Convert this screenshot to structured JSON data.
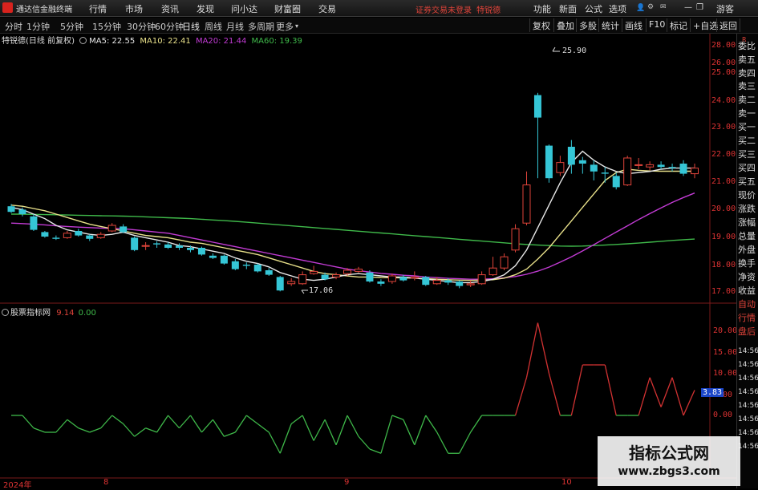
{
  "topbar": {
    "title": "通达信金融终端",
    "menu": [
      "行情",
      "市场",
      "资讯",
      "发现",
      "问小达",
      "财富圈",
      "交易"
    ],
    "notice": "证券交易未登录",
    "tag": "特锐德",
    "right_menu": [
      "功能",
      "新面",
      "公式",
      "选项"
    ],
    "guest": "游客"
  },
  "secbar": {
    "periods": [
      "分时",
      "1分钟",
      "5分钟",
      "15分钟",
      "30分钟",
      "60分钟",
      "日线",
      "周线",
      "月线",
      "多周期",
      "更多"
    ],
    "active": "日线",
    "buttons": [
      "复权",
      "叠加",
      "多股",
      "统计",
      "画线",
      "F10",
      "标记",
      "+自选",
      "返回"
    ]
  },
  "main_legend": {
    "title": "特锐德(日线 前复权)",
    "ma5": "MA5: 22.55",
    "ma10": "MA10: 22.41",
    "ma20": "MA20: 21.44",
    "ma60": "MA60: 19.39"
  },
  "sub_legend": {
    "title": "股票指标网",
    "v1": "9.14",
    "v2": "0.00"
  },
  "price_axis": [
    "28.00",
    "26.00",
    "25.00",
    "24.00",
    "23.00",
    "22.00",
    "21.00",
    "20.00",
    "19.00",
    "18.00",
    "17.00"
  ],
  "sub_axis": [
    "20.00",
    "15.00",
    "10.00",
    "5.00",
    "0.00"
  ],
  "sub_current": "3.83",
  "annotations": {
    "high": "25.90",
    "low": "17.06"
  },
  "dates": [
    "2024年",
    "8",
    "9",
    "10"
  ],
  "right_panel": [
    "委比",
    "卖五",
    "卖四",
    "卖三",
    "卖二",
    "卖一",
    "买一",
    "买二",
    "买三",
    "买四",
    "买五",
    "现价",
    "涨跌",
    "涨幅",
    "总量",
    "外盘",
    "换手",
    "净资",
    "收益",
    "自动",
    "行情",
    "盘后",
    "14:56",
    "14:56",
    "14:56",
    "14:56",
    "14:56",
    "14:56",
    "14:56",
    "14:56"
  ],
  "right_top": "R",
  "watermark": {
    "line1": "指标公式网",
    "line2": "www.zbgs3.com"
  },
  "colors": {
    "up": "#e0443a",
    "down": "#35c6d6",
    "ma5": "#e8e8e8",
    "ma10": "#e8e08a",
    "ma20": "#c23bd4",
    "ma60": "#3fb94a",
    "sub_up": "#d23232",
    "sub_down": "#3fb94a"
  },
  "chart_data": {
    "type": "candlestick",
    "price_ylim": [
      17.0,
      28.0
    ],
    "candles": [
      {
        "o": 20.85,
        "c": 20.6,
        "h": 20.95,
        "l": 20.55
      },
      {
        "o": 20.7,
        "c": 20.5,
        "h": 20.8,
        "l": 20.4
      },
      {
        "o": 20.4,
        "c": 19.8,
        "h": 20.5,
        "l": 19.75
      },
      {
        "o": 19.7,
        "c": 19.5,
        "h": 19.75,
        "l": 19.45
      },
      {
        "o": 19.45,
        "c": 19.4,
        "h": 19.55,
        "l": 19.35
      },
      {
        "o": 19.45,
        "c": 19.65,
        "h": 19.75,
        "l": 19.4
      },
      {
        "o": 19.75,
        "c": 19.55,
        "h": 19.85,
        "l": 19.5
      },
      {
        "o": 19.55,
        "c": 19.4,
        "h": 19.6,
        "l": 19.3
      },
      {
        "o": 19.45,
        "c": 19.6,
        "h": 19.7,
        "l": 19.4
      },
      {
        "o": 19.75,
        "c": 20.0,
        "h": 20.1,
        "l": 19.7
      },
      {
        "o": 19.95,
        "c": 19.7,
        "h": 20.05,
        "l": 19.65
      },
      {
        "o": 19.45,
        "c": 18.9,
        "h": 19.5,
        "l": 18.85
      },
      {
        "o": 19.1,
        "c": 19.1,
        "h": 19.25,
        "l": 18.9
      },
      {
        "o": 19.2,
        "c": 19.15,
        "h": 19.3,
        "l": 19.0
      },
      {
        "o": 19.15,
        "c": 19.0,
        "h": 19.25,
        "l": 18.95
      },
      {
        "o": 19.1,
        "c": 19.0,
        "h": 19.2,
        "l": 18.9
      },
      {
        "o": 19.0,
        "c": 18.9,
        "h": 19.1,
        "l": 18.8
      },
      {
        "o": 19.0,
        "c": 18.7,
        "h": 19.05,
        "l": 18.65
      },
      {
        "o": 18.65,
        "c": 18.55,
        "h": 18.75,
        "l": 18.5
      },
      {
        "o": 18.65,
        "c": 18.3,
        "h": 18.7,
        "l": 18.25
      },
      {
        "o": 18.4,
        "c": 18.05,
        "h": 18.5,
        "l": 18.0
      },
      {
        "o": 18.25,
        "c": 18.2,
        "h": 18.35,
        "l": 18.05
      },
      {
        "o": 18.25,
        "c": 17.95,
        "h": 18.3,
        "l": 17.9
      },
      {
        "o": 18.0,
        "c": 17.8,
        "h": 18.1,
        "l": 17.75
      },
      {
        "o": 17.7,
        "c": 17.1,
        "h": 17.75,
        "l": 17.06
      },
      {
        "o": 17.4,
        "c": 17.5,
        "h": 17.65,
        "l": 17.3
      },
      {
        "o": 17.4,
        "c": 17.8,
        "h": 17.95,
        "l": 17.35
      },
      {
        "o": 17.85,
        "c": 17.95,
        "h": 18.2,
        "l": 17.8
      },
      {
        "o": 17.8,
        "c": 17.6,
        "h": 17.9,
        "l": 17.55
      },
      {
        "o": 17.7,
        "c": 17.8,
        "h": 17.9,
        "l": 17.6
      },
      {
        "o": 17.85,
        "c": 18.0,
        "h": 18.1,
        "l": 17.75
      },
      {
        "o": 17.95,
        "c": 18.05,
        "h": 18.15,
        "l": 17.9
      },
      {
        "o": 17.9,
        "c": 17.5,
        "h": 18.0,
        "l": 17.45
      },
      {
        "o": 17.5,
        "c": 17.4,
        "h": 17.6,
        "l": 17.3
      },
      {
        "o": 17.5,
        "c": 17.75,
        "h": 17.85,
        "l": 17.4
      },
      {
        "o": 17.7,
        "c": 17.55,
        "h": 17.8,
        "l": 17.5
      },
      {
        "o": 17.65,
        "c": 17.7,
        "h": 17.95,
        "l": 17.55
      },
      {
        "o": 17.7,
        "c": 17.35,
        "h": 17.75,
        "l": 17.3
      },
      {
        "o": 17.4,
        "c": 17.55,
        "h": 17.7,
        "l": 17.35
      },
      {
        "o": 17.55,
        "c": 17.45,
        "h": 17.65,
        "l": 17.35
      },
      {
        "o": 17.5,
        "c": 17.3,
        "h": 17.55,
        "l": 17.2
      },
      {
        "o": 17.35,
        "c": 17.4,
        "h": 17.55,
        "l": 17.25
      },
      {
        "o": 17.4,
        "c": 17.8,
        "h": 17.95,
        "l": 17.35
      },
      {
        "o": 17.8,
        "c": 18.1,
        "h": 18.6,
        "l": 17.75
      },
      {
        "o": 18.1,
        "c": 18.6,
        "h": 18.75,
        "l": 18.0
      },
      {
        "o": 18.9,
        "c": 19.85,
        "h": 20.05,
        "l": 18.8
      },
      {
        "o": 20.1,
        "c": 21.8,
        "h": 22.4,
        "l": 20.0
      },
      {
        "o": 25.8,
        "c": 24.8,
        "h": 25.9,
        "l": 22.1
      },
      {
        "o": 23.55,
        "c": 22.1,
        "h": 23.6,
        "l": 21.9
      },
      {
        "o": 22.35,
        "c": 22.8,
        "h": 23.1,
        "l": 22.2
      },
      {
        "o": 23.5,
        "c": 22.7,
        "h": 23.8,
        "l": 22.3
      },
      {
        "o": 22.9,
        "c": 22.75,
        "h": 23.05,
        "l": 22.3
      },
      {
        "o": 22.7,
        "c": 22.4,
        "h": 22.9,
        "l": 22.0
      },
      {
        "o": 22.35,
        "c": 22.3,
        "h": 22.6,
        "l": 21.9
      },
      {
        "o": 22.2,
        "c": 21.7,
        "h": 22.35,
        "l": 21.6
      },
      {
        "o": 21.8,
        "c": 23.0,
        "h": 23.1,
        "l": 21.75
      },
      {
        "o": 22.7,
        "c": 22.7,
        "h": 23.0,
        "l": 22.5
      },
      {
        "o": 22.6,
        "c": 22.7,
        "h": 22.85,
        "l": 22.45
      },
      {
        "o": 22.7,
        "c": 22.6,
        "h": 22.85,
        "l": 22.5
      },
      {
        "o": 22.6,
        "c": 22.55,
        "h": 22.75,
        "l": 22.4
      },
      {
        "o": 22.75,
        "c": 22.3,
        "h": 22.9,
        "l": 22.2
      },
      {
        "o": 22.3,
        "c": 22.55,
        "h": 22.75,
        "l": 22.1
      }
    ],
    "ma5": [
      20.8,
      20.7,
      20.5,
      20.3,
      20.0,
      19.8,
      19.7,
      19.6,
      19.55,
      19.6,
      19.7,
      19.55,
      19.45,
      19.35,
      19.25,
      19.1,
      19.05,
      18.95,
      18.85,
      18.75,
      18.55,
      18.4,
      18.3,
      18.15,
      17.9,
      17.75,
      17.6,
      17.55,
      17.6,
      17.7,
      17.8,
      17.85,
      17.8,
      17.75,
      17.7,
      17.7,
      17.65,
      17.6,
      17.55,
      17.5,
      17.45,
      17.45,
      17.5,
      17.6,
      17.8,
      18.2,
      18.9,
      19.9,
      20.9,
      21.9,
      22.8,
      23.3,
      22.9,
      22.6,
      22.4,
      22.3,
      22.35,
      22.4,
      22.5,
      22.55,
      22.55,
      22.55
    ],
    "ma10": [
      20.9,
      20.85,
      20.75,
      20.65,
      20.5,
      20.35,
      20.2,
      20.05,
      19.95,
      19.85,
      19.75,
      19.65,
      19.55,
      19.5,
      19.45,
      19.35,
      19.25,
      19.2,
      19.1,
      19.0,
      18.9,
      18.8,
      18.7,
      18.55,
      18.4,
      18.25,
      18.1,
      17.95,
      17.85,
      17.8,
      17.75,
      17.7,
      17.7,
      17.68,
      17.67,
      17.66,
      17.65,
      17.63,
      17.6,
      17.58,
      17.56,
      17.55,
      17.56,
      17.58,
      17.65,
      17.8,
      18.05,
      18.5,
      19.0,
      19.6,
      20.2,
      20.8,
      21.4,
      22.0,
      22.35,
      22.5,
      22.45,
      22.42,
      22.41,
      22.41,
      22.41,
      22.41
    ],
    "ma20": [
      20.1,
      20.08,
      20.05,
      20.02,
      19.98,
      19.95,
      19.92,
      19.9,
      19.88,
      19.86,
      19.85,
      19.8,
      19.75,
      19.7,
      19.65,
      19.55,
      19.45,
      19.35,
      19.25,
      19.15,
      19.05,
      18.95,
      18.85,
      18.75,
      18.65,
      18.55,
      18.45,
      18.35,
      18.25,
      18.15,
      18.05,
      17.98,
      17.92,
      17.86,
      17.82,
      17.78,
      17.75,
      17.7,
      17.67,
      17.64,
      17.62,
      17.6,
      17.6,
      17.62,
      17.66,
      17.72,
      17.82,
      17.96,
      18.14,
      18.36,
      18.6,
      18.86,
      19.14,
      19.42,
      19.7,
      19.98,
      20.26,
      20.52,
      20.78,
      21.02,
      21.24,
      21.44
    ],
    "ma60": [
      20.5,
      20.5,
      20.49,
      20.48,
      20.47,
      20.46,
      20.45,
      20.44,
      20.43,
      20.42,
      20.41,
      20.4,
      20.38,
      20.36,
      20.34,
      20.32,
      20.3,
      20.27,
      20.24,
      20.21,
      20.18,
      20.14,
      20.1,
      20.06,
      20.02,
      19.98,
      19.94,
      19.9,
      19.86,
      19.82,
      19.78,
      19.74,
      19.7,
      19.66,
      19.62,
      19.58,
      19.54,
      19.5,
      19.46,
      19.42,
      19.38,
      19.34,
      19.3,
      19.26,
      19.22,
      19.18,
      19.15,
      19.12,
      19.1,
      19.08,
      19.07,
      19.08,
      19.1,
      19.12,
      19.15,
      19.18,
      19.21,
      19.25,
      19.29,
      19.33,
      19.36,
      19.39
    ],
    "sub_ylim": [
      -10,
      22
    ],
    "sub_values": [
      0,
      0,
      -3,
      -4,
      -4,
      -1,
      -3,
      -4,
      -3,
      0,
      -2,
      -5,
      -3,
      -4,
      0,
      -3,
      0,
      -4,
      -1,
      -5,
      -4,
      0,
      -2,
      -4,
      -9,
      -2,
      0,
      -6,
      -1,
      -7,
      0,
      -5,
      -8,
      -9,
      0,
      -1,
      -7,
      0,
      -4,
      -9,
      -9,
      -4,
      0,
      0,
      0,
      0,
      9,
      22,
      10,
      0,
      0,
      12,
      12,
      12,
      0,
      0,
      0,
      9,
      2,
      9,
      0,
      6
    ]
  }
}
